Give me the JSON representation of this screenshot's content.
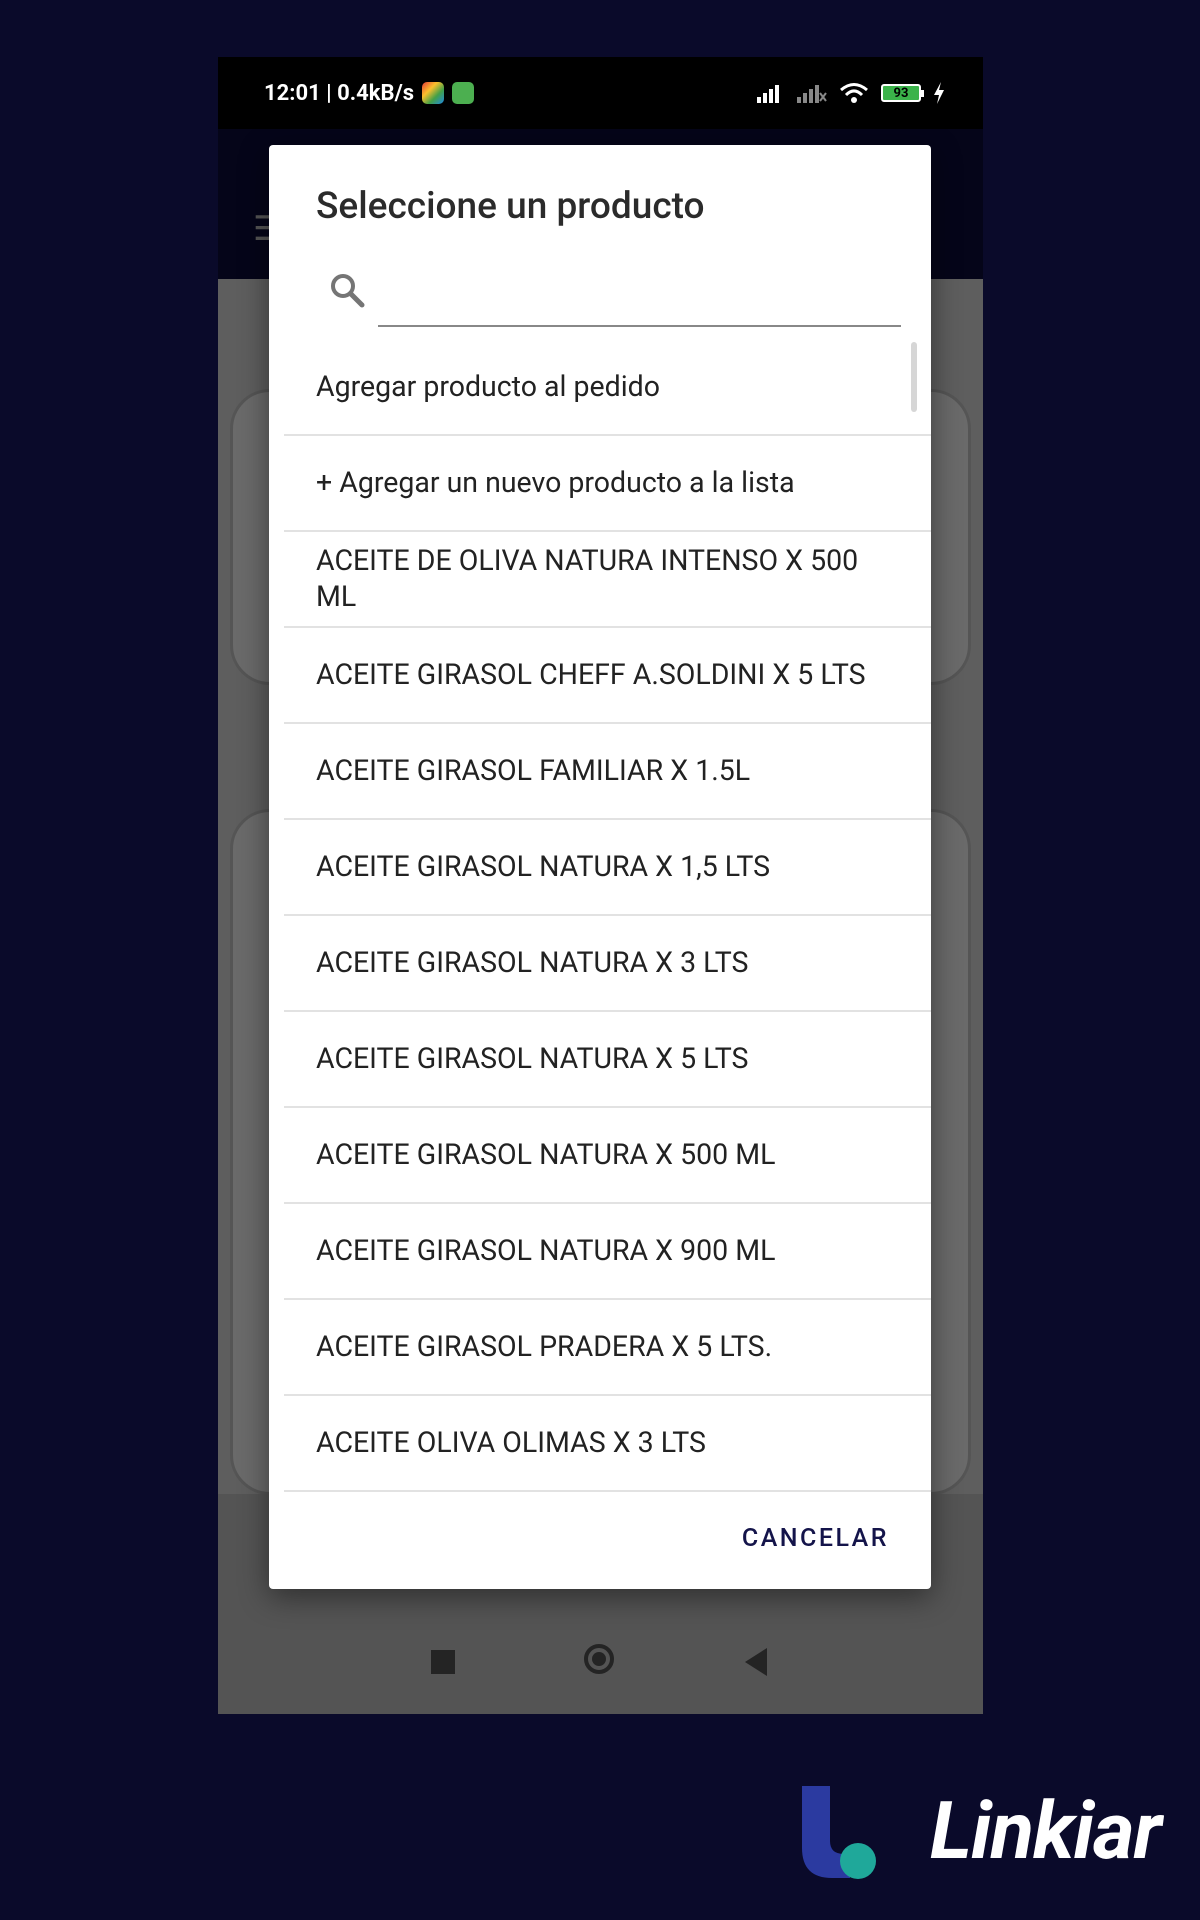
{
  "status_bar": {
    "time_speed": "12:01 | 0.4kB/s",
    "battery": "93"
  },
  "dialog": {
    "title": "Seleccione un producto",
    "search_placeholder": "",
    "items": [
      "Agregar producto al pedido",
      "+ Agregar un nuevo producto a la lista",
      "ACEITE DE OLIVA NATURA INTENSO X 500 ML",
      "ACEITE GIRASOL CHEFF A.SOLDINI X 5 LTS",
      "ACEITE GIRASOL FAMILIAR X 1.5L",
      "ACEITE GIRASOL NATURA X 1,5 LTS",
      "ACEITE GIRASOL NATURA X 3 LTS",
      "ACEITE GIRASOL NATURA X 5 LTS",
      "ACEITE GIRASOL NATURA X 500 ML",
      "ACEITE GIRASOL NATURA X 900 ML",
      "ACEITE GIRASOL PRADERA X 5 LTS.",
      "ACEITE OLIVA OLIMAS X 3 LTS"
    ],
    "cancel_label": "CANCELAR"
  },
  "logo": {
    "text": "Linkiar"
  },
  "colors": {
    "background": "#0a0a2a",
    "accent": "#14144a",
    "logo_blue": "#2b3aa0",
    "logo_teal": "#1fa89a"
  }
}
